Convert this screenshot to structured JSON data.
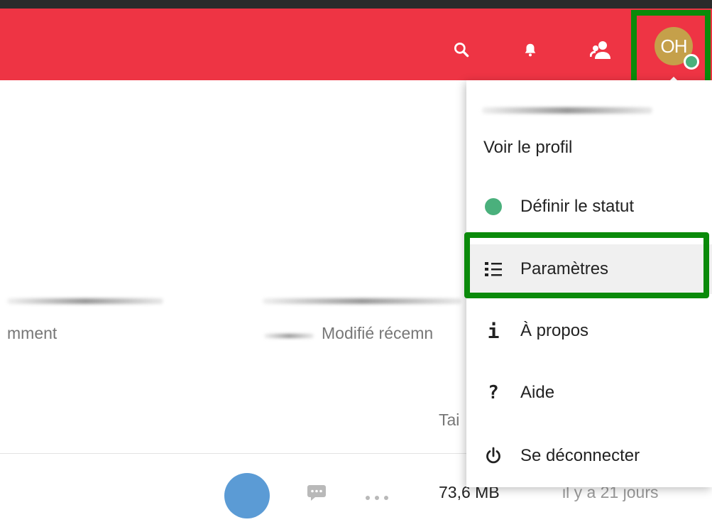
{
  "header": {
    "user_initials": "OH",
    "colors": {
      "bar": "#ee3444",
      "avatar": "#c5a04a",
      "status": "#4ab07c"
    },
    "icons": [
      "search-icon",
      "bell-icon",
      "contacts-icon"
    ]
  },
  "background": {
    "col1_label": "mment",
    "col2_label": "Modifié récemn",
    "col2_size_label": "Tai",
    "row": {
      "size": "73,6 MB",
      "date": "il y a 21 jours"
    }
  },
  "menu": {
    "items": [
      {
        "label": "Voir le profil",
        "icon": ""
      },
      {
        "label": "Définir le statut",
        "icon": "status-dot-icon"
      },
      {
        "label": "Paramètres",
        "icon": "settings-list-icon"
      },
      {
        "label": "À propos",
        "icon": "info-icon"
      },
      {
        "label": "Aide",
        "icon": "help-icon"
      },
      {
        "label": "Se déconnecter",
        "icon": "power-icon"
      }
    ],
    "glyphs": {
      "info": "i",
      "help": "?"
    }
  }
}
